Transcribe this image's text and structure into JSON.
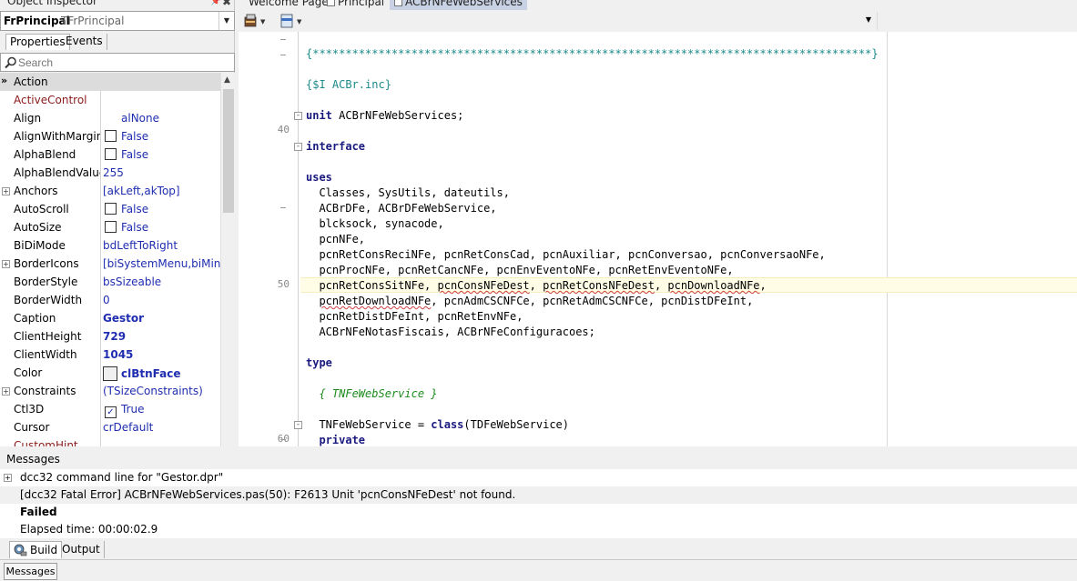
{
  "object_inspector": {
    "title": "Object Inspector",
    "component_name": "FrPrincipal",
    "component_type": "TFrPrincipal",
    "tabs": [
      "Properties",
      "Events"
    ],
    "search_placeholder": "Search",
    "properties": [
      {
        "name": "Action",
        "value": ""
      },
      {
        "name": "ActiveControl",
        "value": ""
      },
      {
        "name": "Align",
        "value": "alNone"
      },
      {
        "name": "AlignWithMargins",
        "value": "False"
      },
      {
        "name": "AlphaBlend",
        "value": "False"
      },
      {
        "name": "AlphaBlendValue",
        "value": "255"
      },
      {
        "name": "Anchors",
        "value": "[akLeft,akTop]"
      },
      {
        "name": "AutoScroll",
        "value": "False"
      },
      {
        "name": "AutoSize",
        "value": "False"
      },
      {
        "name": "BiDiMode",
        "value": "bdLeftToRight"
      },
      {
        "name": "BorderIcons",
        "value": "[biSystemMenu,biMinim"
      },
      {
        "name": "BorderStyle",
        "value": "bsSizeable"
      },
      {
        "name": "BorderWidth",
        "value": "0"
      },
      {
        "name": "Caption",
        "value": "Gestor"
      },
      {
        "name": "ClientHeight",
        "value": "729"
      },
      {
        "name": "ClientWidth",
        "value": "1045"
      },
      {
        "name": "Color",
        "value": "clBtnFace"
      },
      {
        "name": "Constraints",
        "value": "(TSizeConstraints)"
      },
      {
        "name": "Ctl3D",
        "value": "True"
      },
      {
        "name": "Cursor",
        "value": "crDefault"
      },
      {
        "name": "CustomHint",
        "value": ""
      }
    ]
  },
  "editor": {
    "tabs": [
      "Welcome Page",
      "Principal",
      "ACBrNFeWebServices"
    ],
    "line_numbers": {
      "l40": "40",
      "l50": "50",
      "l60": "60"
    },
    "code": {
      "banner": "{*************************************************************************************}",
      "include": "{$I ACBr.inc}",
      "unit_kw": "unit",
      "unit_name": " ACBrNFeWebServices;",
      "interface_kw": "interface",
      "uses_kw": "uses",
      "u1": "  Classes, SysUtils, dateutils,",
      "u2": "  ACBrDFe, ACBrDFeWebService,",
      "u3": "  blcksock, synacode,",
      "u4": "  pcnNFe,",
      "u5": "  pcnRetConsReciNFe, pcnRetConsCad, pcnAuxiliar, pcnConversao, pcnConversaoNFe,",
      "u6": "  pcnProcNFe, pcnRetCancNFe, pcnEnvEventoNFe, pcnRetEnvEventoNFe,",
      "u7a": "  pcnRetConsSitNFe, ",
      "u7b": "pcnConsNFeDest",
      "u7c": ", ",
      "u7d": "pcnRetConsNFeDest",
      "u7e": ", ",
      "u7f": "pcnDownloadNFe",
      "u7g": ",",
      "u8a": "  ",
      "u8b": "pcnRetDownloadNFe",
      "u8c": ", pcnAdmCSCNFCe, pcnRetAdmCSCNFCe, pcnDistDFeInt,",
      "u9": "  pcnRetDistDFeInt, pcnRetEnvNFe,",
      "u10": "  ACBrNFeNotasFiscais, ACBrNFeConfiguracoes;",
      "type_kw": "type",
      "comment": "  { TNFeWebService }",
      "cls_a": "  TNFeWebService = ",
      "cls_kw": "class",
      "cls_b": "(TDFeWebService)",
      "private_kw": "  private"
    }
  },
  "messages": {
    "title": "Messages",
    "rows": [
      "dcc32 command line for \"Gestor.dpr\"",
      "[dcc32 Fatal Error] ACBrNFeWebServices.pas(50): F2613 Unit 'pcnConsNFeDest' not found.",
      "Failed",
      "Elapsed time: 00:00:02.9"
    ],
    "tabs": [
      "Build",
      "Output"
    ]
  },
  "status_bar": {
    "button": "Messages"
  }
}
